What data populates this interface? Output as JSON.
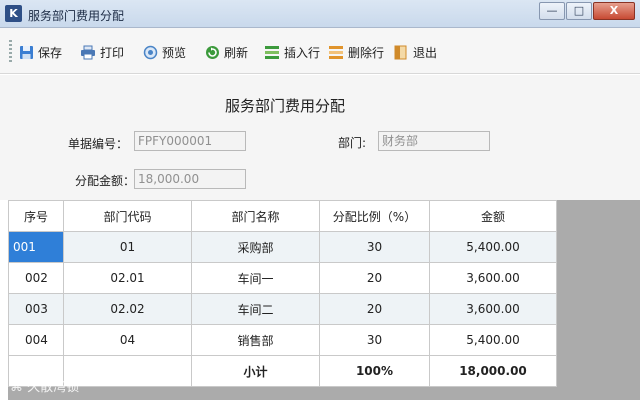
{
  "window": {
    "title": "服务部门费用分配",
    "icon_name": "app-logo-icon",
    "controls": {
      "minimize": "—",
      "maximize": "□",
      "close": "X"
    }
  },
  "toolbar": {
    "items": [
      {
        "label": "保存",
        "icon": "save-icon"
      },
      {
        "label": "打印",
        "icon": "print-icon"
      },
      {
        "label": "预览",
        "icon": "preview-icon"
      },
      {
        "label": "刷新",
        "icon": "refresh-icon"
      },
      {
        "label": "插入行",
        "icon": "insert-row-icon"
      },
      {
        "label": "删除行",
        "icon": "delete-row-icon"
      },
      {
        "label": "退出",
        "icon": "exit-icon"
      }
    ]
  },
  "form": {
    "title": "服务部门费用分配",
    "doc_no_label": "单据编号：",
    "doc_no_value": "FPFY000001",
    "dept_label": "部门:",
    "dept_value": "财务部",
    "amount_label": "分配金额：",
    "amount_value": "18,000.00"
  },
  "grid": {
    "columns": [
      "序号",
      "部门代码",
      "部门名称",
      "分配比例（%）",
      "金额"
    ],
    "rows": [
      {
        "seq": "001",
        "code": "01",
        "name": "采购部",
        "ratio": "30",
        "amount": "5,400.00"
      },
      {
        "seq": "002",
        "code": "02.01",
        "name": "车间一",
        "ratio": "20",
        "amount": "3,600.00"
      },
      {
        "seq": "003",
        "code": "02.02",
        "name": "车间二",
        "ratio": "20",
        "amount": "3,600.00"
      },
      {
        "seq": "004",
        "code": "04",
        "name": "销售部",
        "ratio": "30",
        "amount": "5,400.00"
      }
    ],
    "total": {
      "label": "小计",
      "ratio": "100%",
      "amount": "18,000.00"
    }
  },
  "watermark": "⌘ 久散湾锁",
  "colors": {
    "selection": "#2f7fd8",
    "title_bar": "#c9d9ec",
    "grid_empty": "#ababab"
  }
}
